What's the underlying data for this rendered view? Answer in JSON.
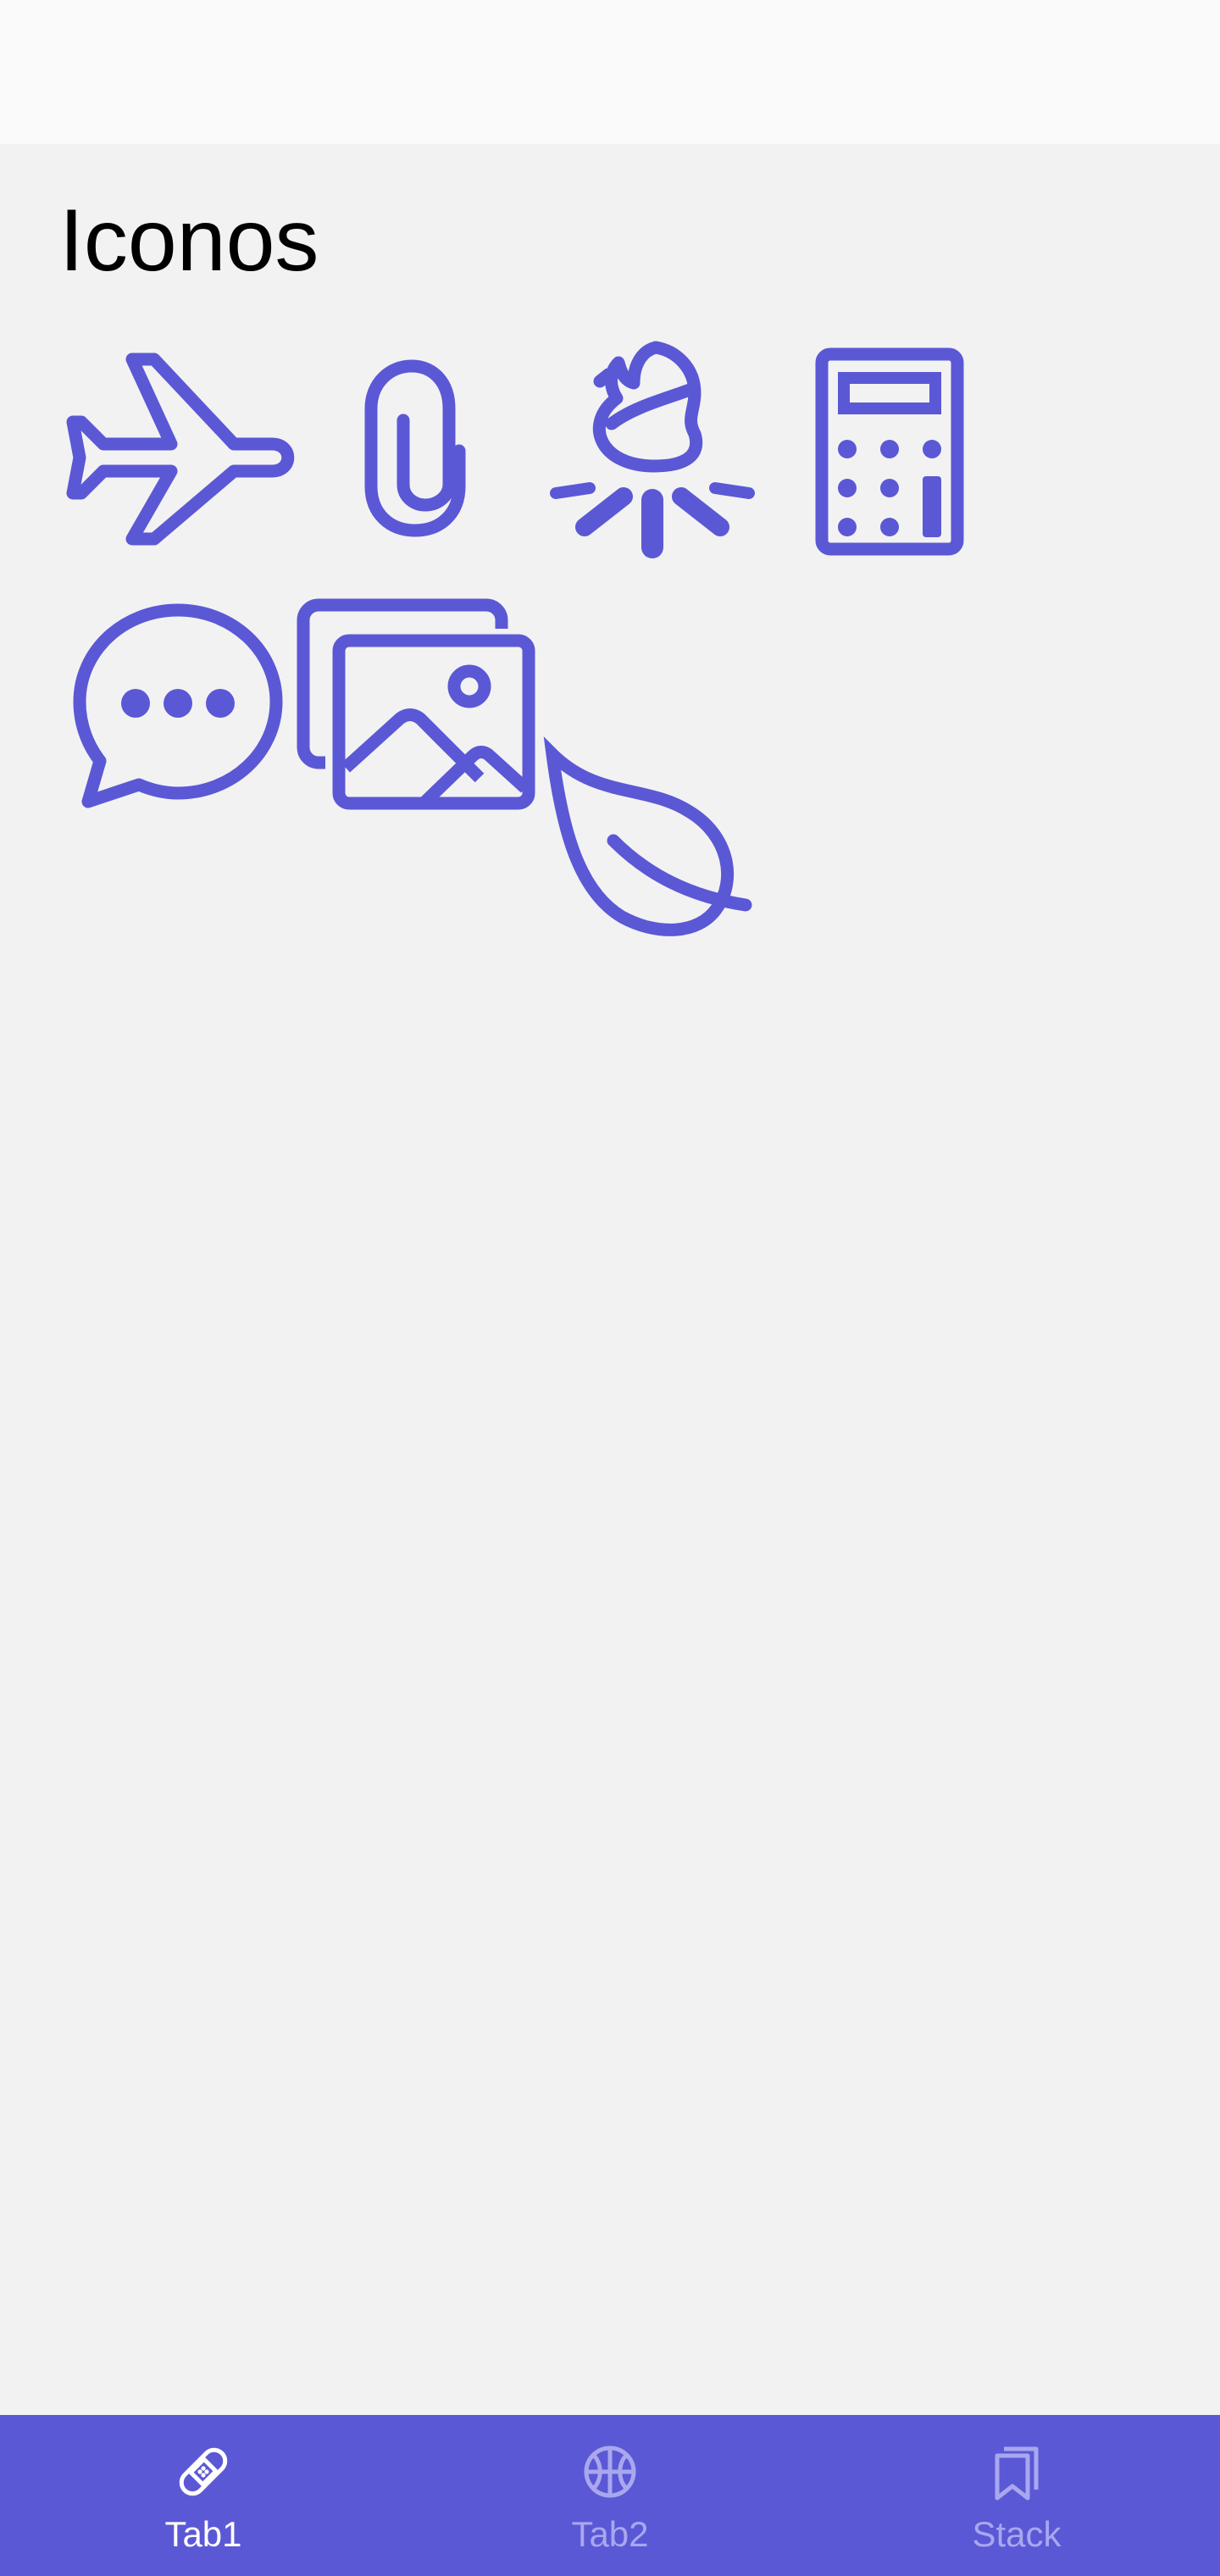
{
  "screen": {
    "title": "Iconos"
  },
  "icons": [
    "airplane-icon",
    "paperclip-icon",
    "campfire-icon",
    "calculator-icon",
    "chat-bubble-ellipsis-icon",
    "images-icon",
    "leaf-icon"
  ],
  "tab_bar": {
    "tabs": [
      {
        "label": "Tab1",
        "icon": "bandage-icon",
        "active": true
      },
      {
        "label": "Tab2",
        "icon": "basketball-icon",
        "active": false
      },
      {
        "label": "Stack",
        "icon": "bookmarks-icon",
        "active": false
      }
    ]
  },
  "colors": {
    "accent": "#5b58d6",
    "tab_active_text": "#ffffff",
    "tab_inactive_text": "#a9a7ee",
    "background": "#f2f2f2",
    "status_bar": "#fafafa"
  }
}
